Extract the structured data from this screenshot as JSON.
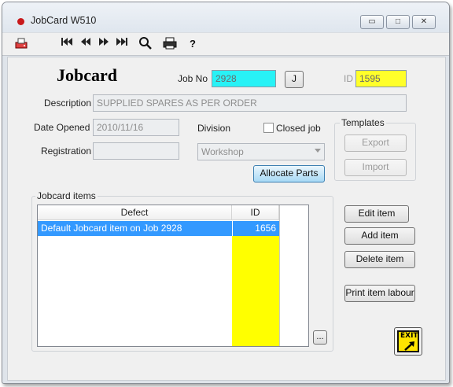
{
  "window": {
    "title": "JobCard W510",
    "controls": {
      "minimize": "▭",
      "maximize": "□",
      "close": "✕"
    }
  },
  "toolbar": {
    "icons": [
      "printer-tray-icon",
      "first-record-icon",
      "previous-record-icon",
      "next-record-icon",
      "last-record-icon",
      "search-icon",
      "print-icon",
      "help-icon"
    ]
  },
  "form": {
    "heading": "Jobcard",
    "job_no_label": "Job No",
    "job_no_value": "2928",
    "j_button": "J",
    "id_label": "ID",
    "id_value": "1595",
    "description_label": "Description",
    "description_value": "SUPPLIED SPARES AS PER ORDER",
    "date_opened_label": "Date Opened",
    "date_opened_value": "2010/11/16",
    "division_label": "Division",
    "division_value": "Workshop",
    "closed_job_label": "Closed job",
    "closed_job_checked": false,
    "registration_label": "Registration",
    "registration_value": "",
    "allocate_parts_button": "Allocate Parts"
  },
  "templates": {
    "title": "Templates",
    "export_button": "Export",
    "import_button": "Import"
  },
  "items": {
    "title": "Jobcard items",
    "columns": [
      "Defect",
      "ID"
    ],
    "rows": [
      {
        "defect": "Default Jobcard item on Job 2928",
        "id": "1656"
      }
    ],
    "more_button": "..."
  },
  "item_buttons": {
    "edit": "Edit item",
    "add": "Add item",
    "delete": "Delete item",
    "print_labour": "Print item labour"
  },
  "exit_button": "EXIT",
  "colors": {
    "accent_cyan": "#28f2f6",
    "accent_yellow": "#ffff2a",
    "selection_blue": "#3399ff",
    "close_dot_red": "#c8191b"
  }
}
